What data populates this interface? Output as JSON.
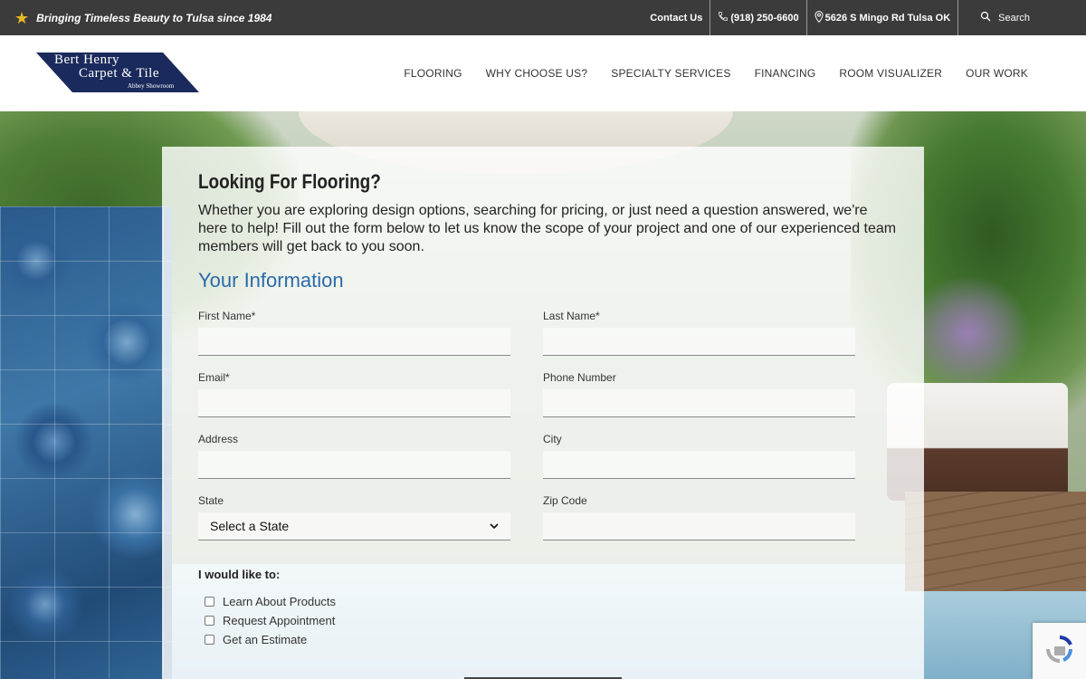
{
  "topbar": {
    "tagline": "Bringing Timeless Beauty to Tulsa since 1984",
    "contact": "Contact Us",
    "phone": "(918) 250-6600",
    "address": "5626 S Mingo Rd Tulsa OK",
    "search": "Search"
  },
  "logo": {
    "line1": "Bert Henry",
    "line2": "Carpet & Tile",
    "line3": "Abbey Showroom"
  },
  "nav": [
    "FLOORING",
    "WHY CHOOSE US?",
    "SPECIALTY SERVICES",
    "FINANCING",
    "ROOM VISUALIZER",
    "OUR WORK"
  ],
  "form": {
    "heading": "Looking For Flooring?",
    "intro": "Whether you are exploring design options, searching for pricing, or just need a question answered, we're here to help! Fill out the form below to let us know the scope of your project and one of our experienced team members will get back to you soon.",
    "section_title": "Your Information",
    "fields": {
      "first_name": "First Name*",
      "last_name": "Last Name*",
      "email": "Email*",
      "phone": "Phone Number",
      "address": "Address",
      "city": "City",
      "state": "State",
      "zip": "Zip Code"
    },
    "state_selected": "Select a State",
    "like_label": "I would like to:",
    "options": [
      "Learn About Products",
      "Request Appointment",
      "Get an Estimate"
    ]
  },
  "icons": {
    "tagline": "star-icon",
    "phone": "phone-icon",
    "address": "map-pin-icon",
    "search": "search-icon",
    "select": "chevron-down-icon",
    "recaptcha": "recaptcha-icon"
  },
  "colors": {
    "topbar_bg": "#3b3b3b",
    "accent_blue": "#2b6aa8",
    "logo_navy": "#1b2a5c",
    "star": "#e8b923"
  }
}
